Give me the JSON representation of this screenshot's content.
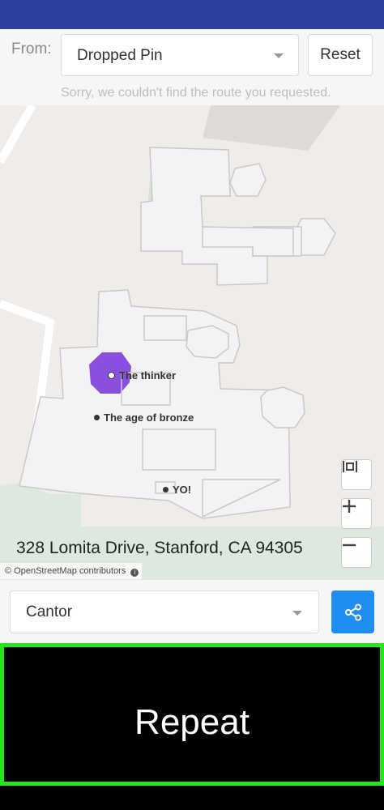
{
  "route": {
    "from_label": "From:",
    "from_value": "Dropped Pin",
    "reset_label": "Reset",
    "error_message": "Sorry, we couldn't find the route you requested."
  },
  "map": {
    "pois": [
      {
        "name": "The thinker",
        "marker": "ring"
      },
      {
        "name": "The age of bronze",
        "marker": "dot"
      },
      {
        "name": "YO!",
        "marker": "dot"
      }
    ],
    "address": "328 Lomita Drive, Stanford, CA 94305",
    "attribution": "© OpenStreetMap contributors",
    "highlight_color": "#8b4fe0",
    "controls": [
      "fit-bounds-icon",
      "zoom-in-icon",
      "zoom-out-icon"
    ]
  },
  "destination": {
    "value": "Cantor",
    "share_icon": "share-icon",
    "share_color": "#1e8ef2"
  },
  "repeat": {
    "label": "Repeat",
    "border_color": "#22e81b"
  },
  "status_bar_color": "#2e3e9f"
}
